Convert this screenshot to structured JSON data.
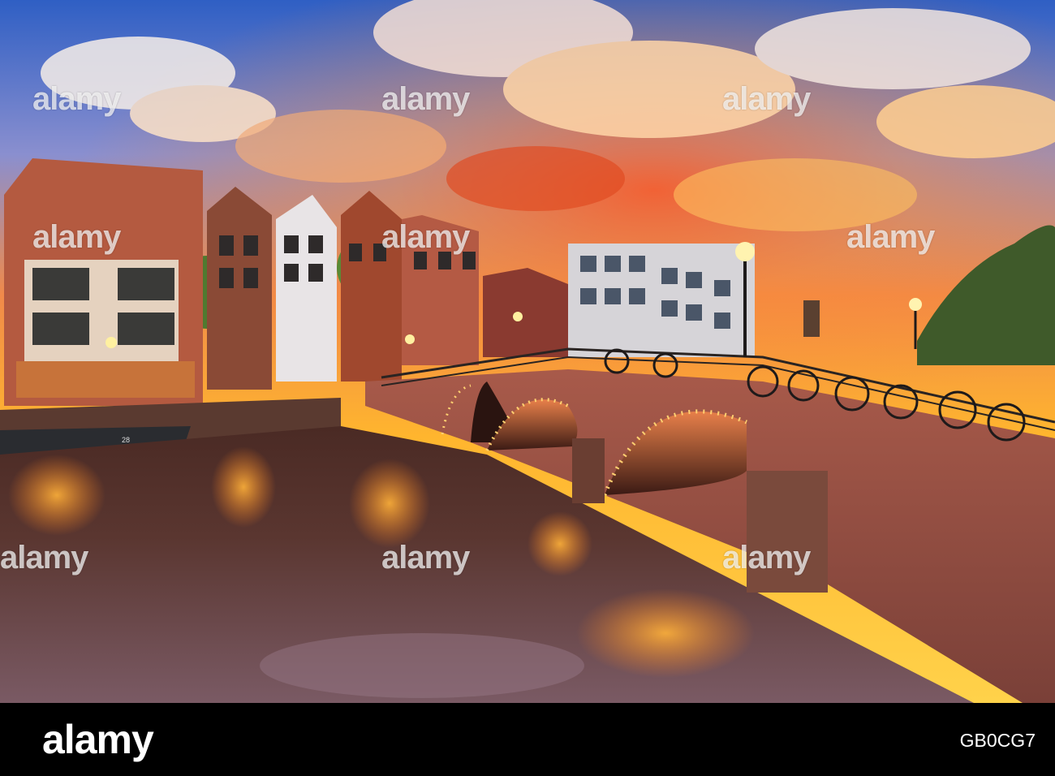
{
  "photo": {
    "boat_number": "28"
  },
  "watermark": {
    "text": "alamy"
  },
  "footer": {
    "logo": "alamy",
    "image_id": "GB0CG7"
  }
}
